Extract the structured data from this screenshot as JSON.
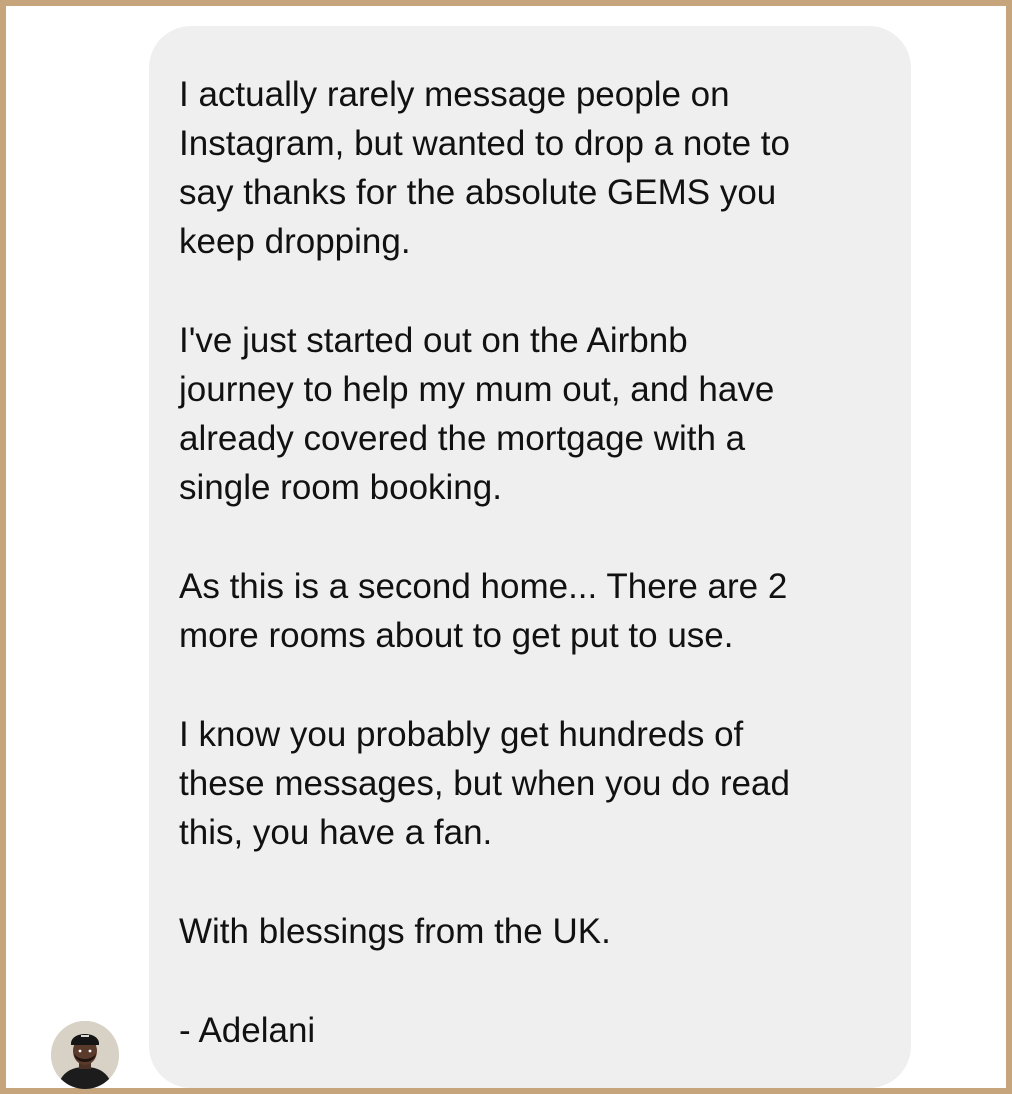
{
  "message": {
    "paragraphs": [
      "I actually rarely message people on\nInstagram, but wanted to drop a note to\nsay thanks for the absolute GEMS you\nkeep dropping.",
      "I've just started out on the Airbnb\njourney to help my mum out, and have\nalready covered the mortgage with a\nsingle room booking.",
      "As this is a second home... There are 2\nmore rooms about to get put to use.",
      "I know you probably get hundreds of\nthese messages, but when you do read\nthis, you have a fan.",
      "With blessings from the UK.",
      "- Adelani"
    ]
  },
  "sender": {
    "avatar_icon": "profile-photo"
  },
  "colors": {
    "frame_border": "#c6a57d",
    "bubble_background": "#efeff0",
    "text": "#111111"
  }
}
